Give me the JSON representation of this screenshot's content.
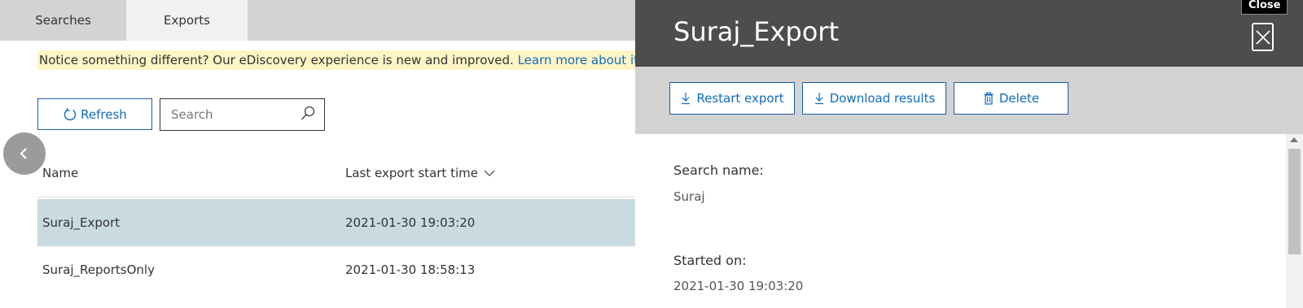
{
  "tabs": [
    {
      "label": "Searches",
      "active": false
    },
    {
      "label": "Exports",
      "active": true
    }
  ],
  "notice": {
    "text": "Notice something different? Our eDiscovery experience is new and improved.",
    "link": "Learn more about it."
  },
  "toolbar": {
    "refresh_label": "Refresh",
    "refresh_icon": "refresh-icon",
    "search_placeholder": "Search",
    "search_value": "",
    "search_icon": "search-icon"
  },
  "table": {
    "columns": [
      "Name",
      "Last export start time"
    ],
    "sort_icon": "chevron-down-icon",
    "rows": [
      {
        "name": "Suraj_Export",
        "time": "2021-01-30 19:03:20",
        "selected": true
      },
      {
        "name": "Suraj_ReportsOnly",
        "time": "2021-01-30 18:58:13",
        "selected": false
      }
    ]
  },
  "panel": {
    "title": "Suraj_Export",
    "close_tooltip": "Close",
    "close_icon": "close-icon",
    "actions": [
      {
        "label": "Restart export",
        "icon": "download-icon"
      },
      {
        "label": "Download results",
        "icon": "download-icon"
      },
      {
        "label": "Delete",
        "icon": "trash-icon"
      }
    ],
    "details": [
      {
        "label": "Search name:",
        "value": "Suraj"
      },
      {
        "label": "Started on:",
        "value": "2021-01-30 19:03:20"
      }
    ]
  },
  "colors": {
    "accent": "#0f6cbd",
    "header_bg": "#4d4d4d",
    "toolbar_bg": "#d3d3d3",
    "selected_row": "#c9dbe1",
    "notice_bg": "#fff4c4"
  }
}
